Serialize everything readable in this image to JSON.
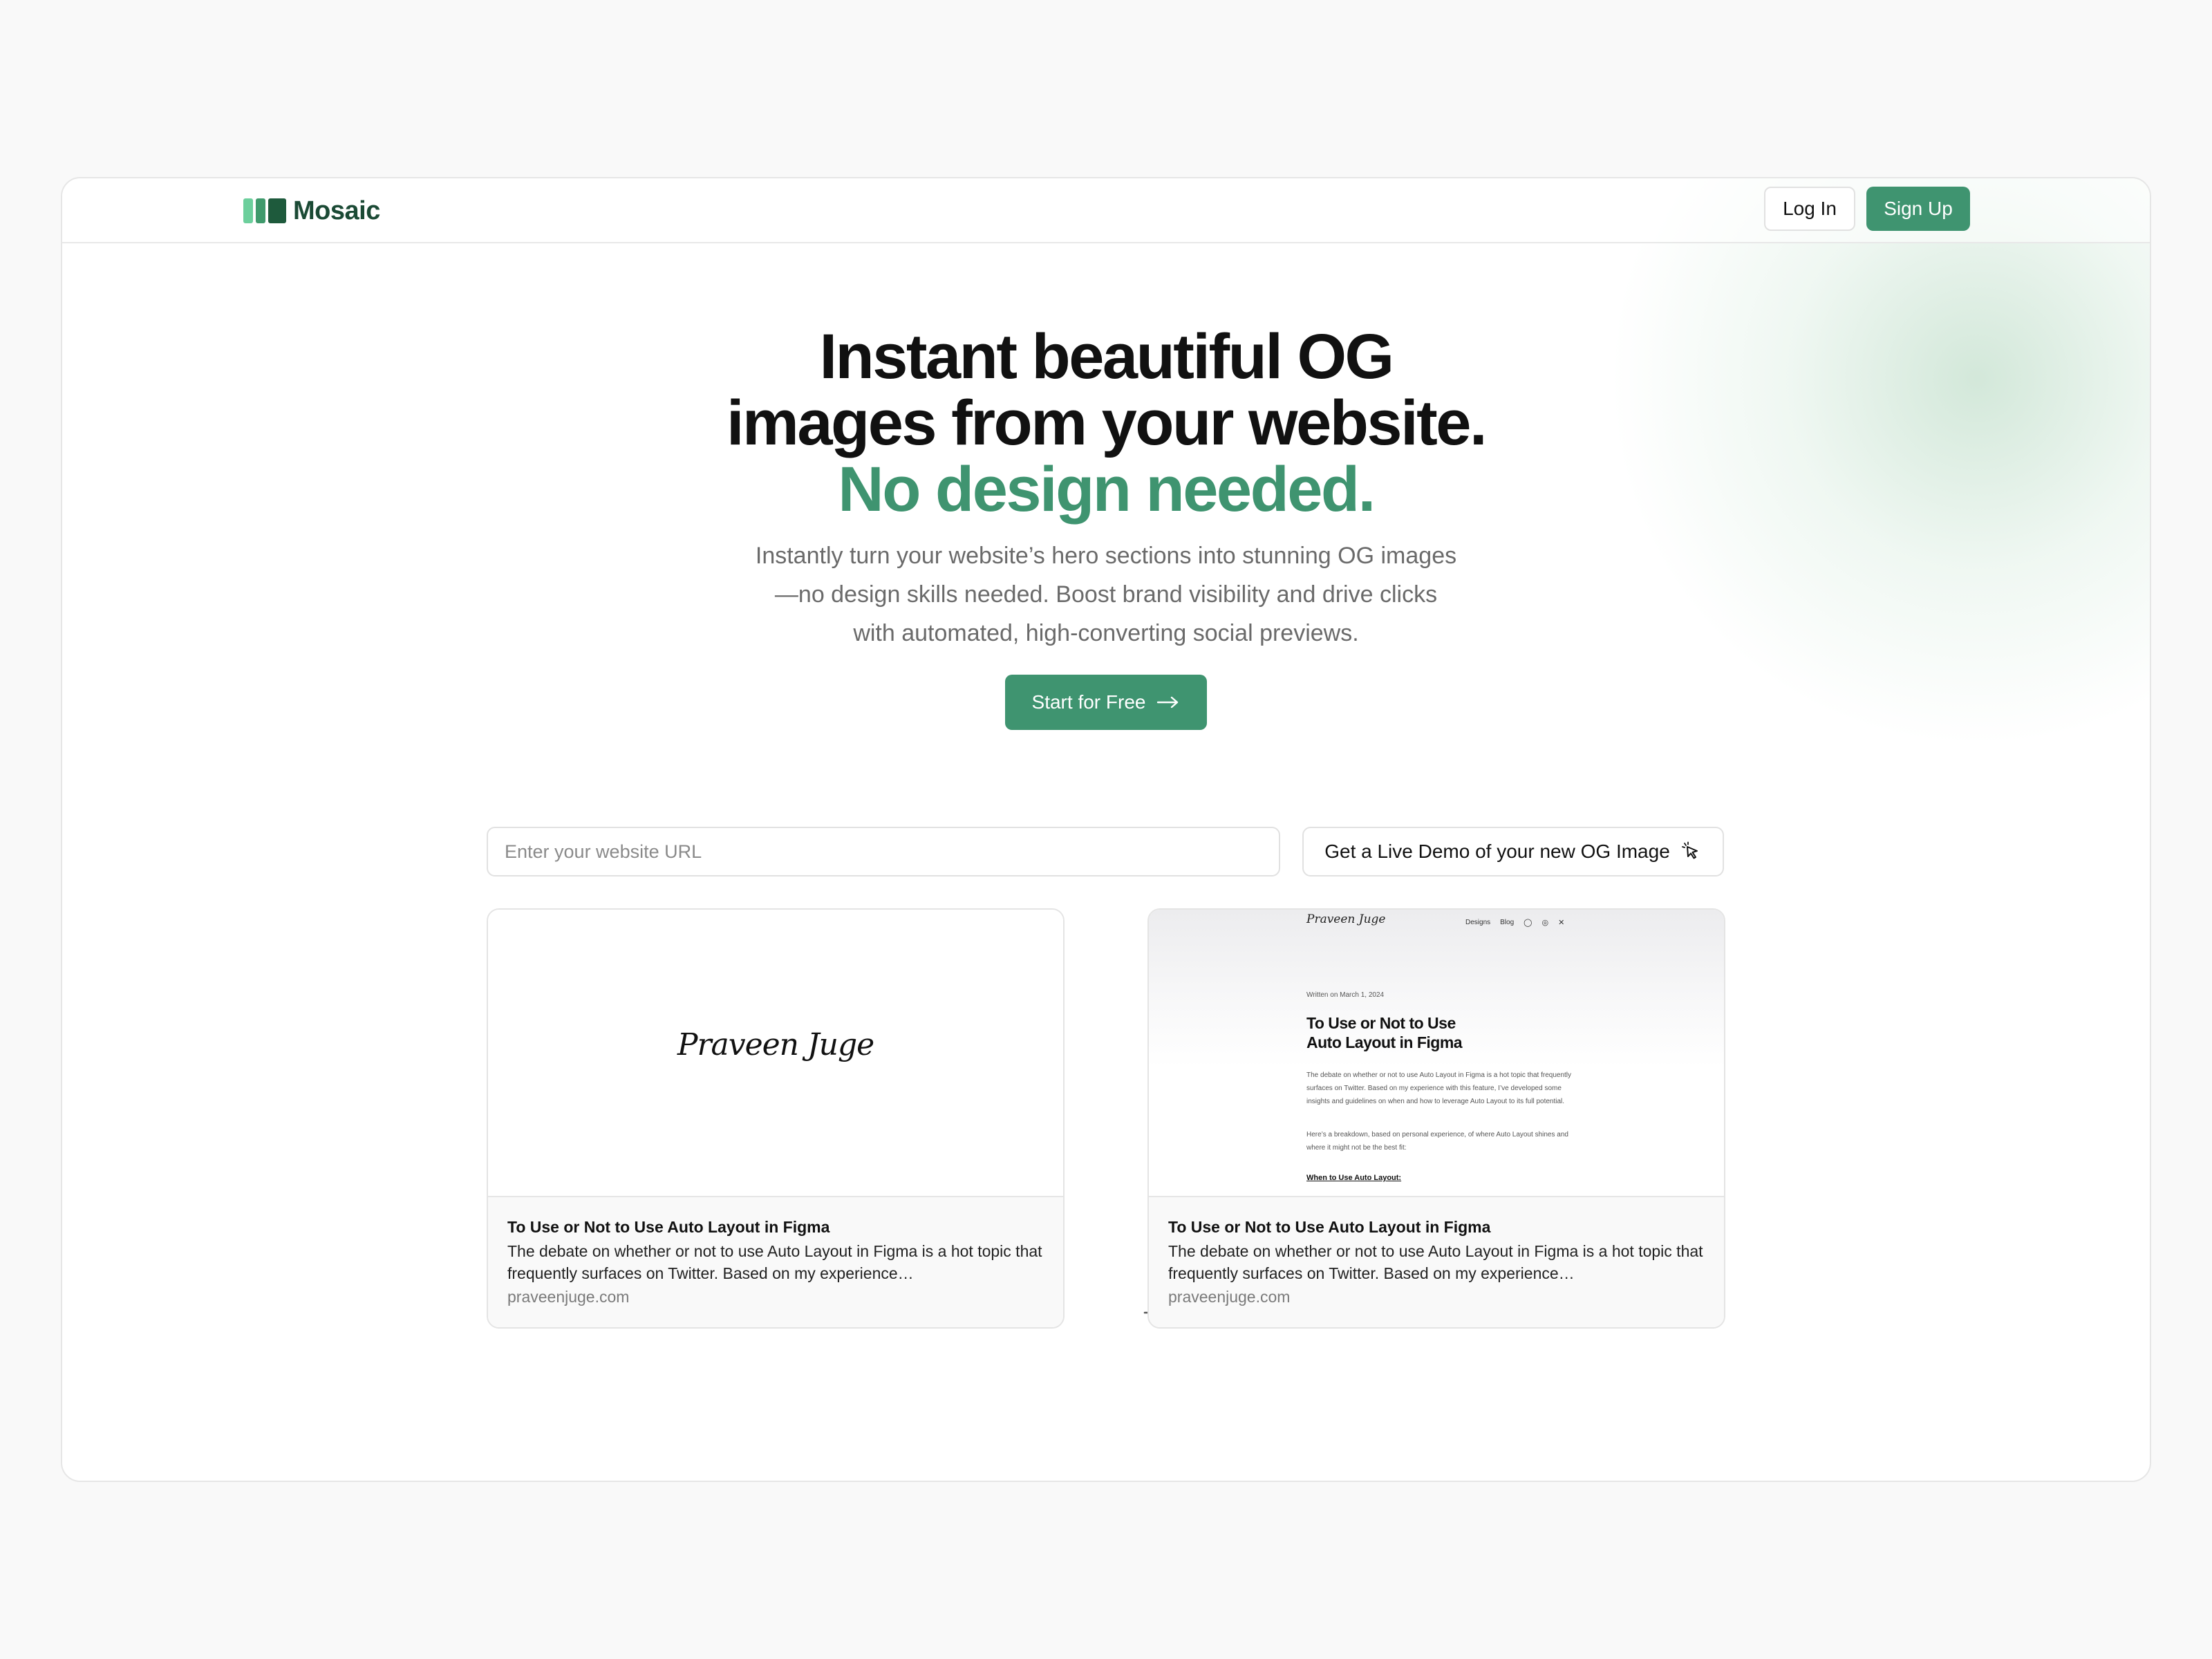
{
  "brand": {
    "name": "Mosaic",
    "accent": "#3f9470"
  },
  "nav": {
    "login_label": "Log In",
    "signup_label": "Sign Up"
  },
  "hero": {
    "title_line1": "Instant beautiful OG",
    "title_line2": "images from your website.",
    "title_accent": "No design needed.",
    "subtitle": "Instantly turn your website’s hero sections into stunning OG images—no design skills needed. Boost brand visibility and drive clicks with automated, high-converting social previews.",
    "cta_label": "Start for Free",
    "cta_icon": "arrow-right-icon"
  },
  "demo": {
    "url_placeholder": "Enter your website URL",
    "demo_button_label": "Get a Live Demo of your new OG Image",
    "demo_button_icon": "pointer-click-icon"
  },
  "preview_cards": [
    {
      "signature": "Praveen Juge",
      "title": "To Use or Not to Use Auto Layout in Figma",
      "description": "The debate on whether or not to use Auto Layout in Figma is a hot topic that frequently surfaces on Twitter. Based on my experience…",
      "domain": "praveenjuge.com"
    },
    {
      "title": "To Use or Not to Use Auto Layout in Figma",
      "description": "The debate on whether or not to use Auto Layout in Figma is a hot topic that frequently surfaces on Twitter. Based on my experience…",
      "domain": "praveenjuge.com",
      "screenshot": {
        "signature": "Praveen Juge",
        "nav_items": [
          "Designs",
          "Blog"
        ],
        "nav_icons": [
          "github-icon",
          "globe-icon",
          "x-icon"
        ],
        "date": "Written on March 1, 2024",
        "title_line1": "To Use or Not to Use",
        "title_line2": "Auto Layout in Figma",
        "paragraph1": "The debate on whether or not to use Auto Layout in Figma is a hot topic that frequently surfaces on Twitter. Based on my experience with this feature, I’ve developed some insights and guidelines on when and how to leverage Auto Layout to its full potential.",
        "paragraph2": "Here’s a breakdown, based on personal experience, of where Auto Layout shines and where it might not be the best fit:",
        "heading": "When to Use Auto Layout:"
      }
    }
  ]
}
